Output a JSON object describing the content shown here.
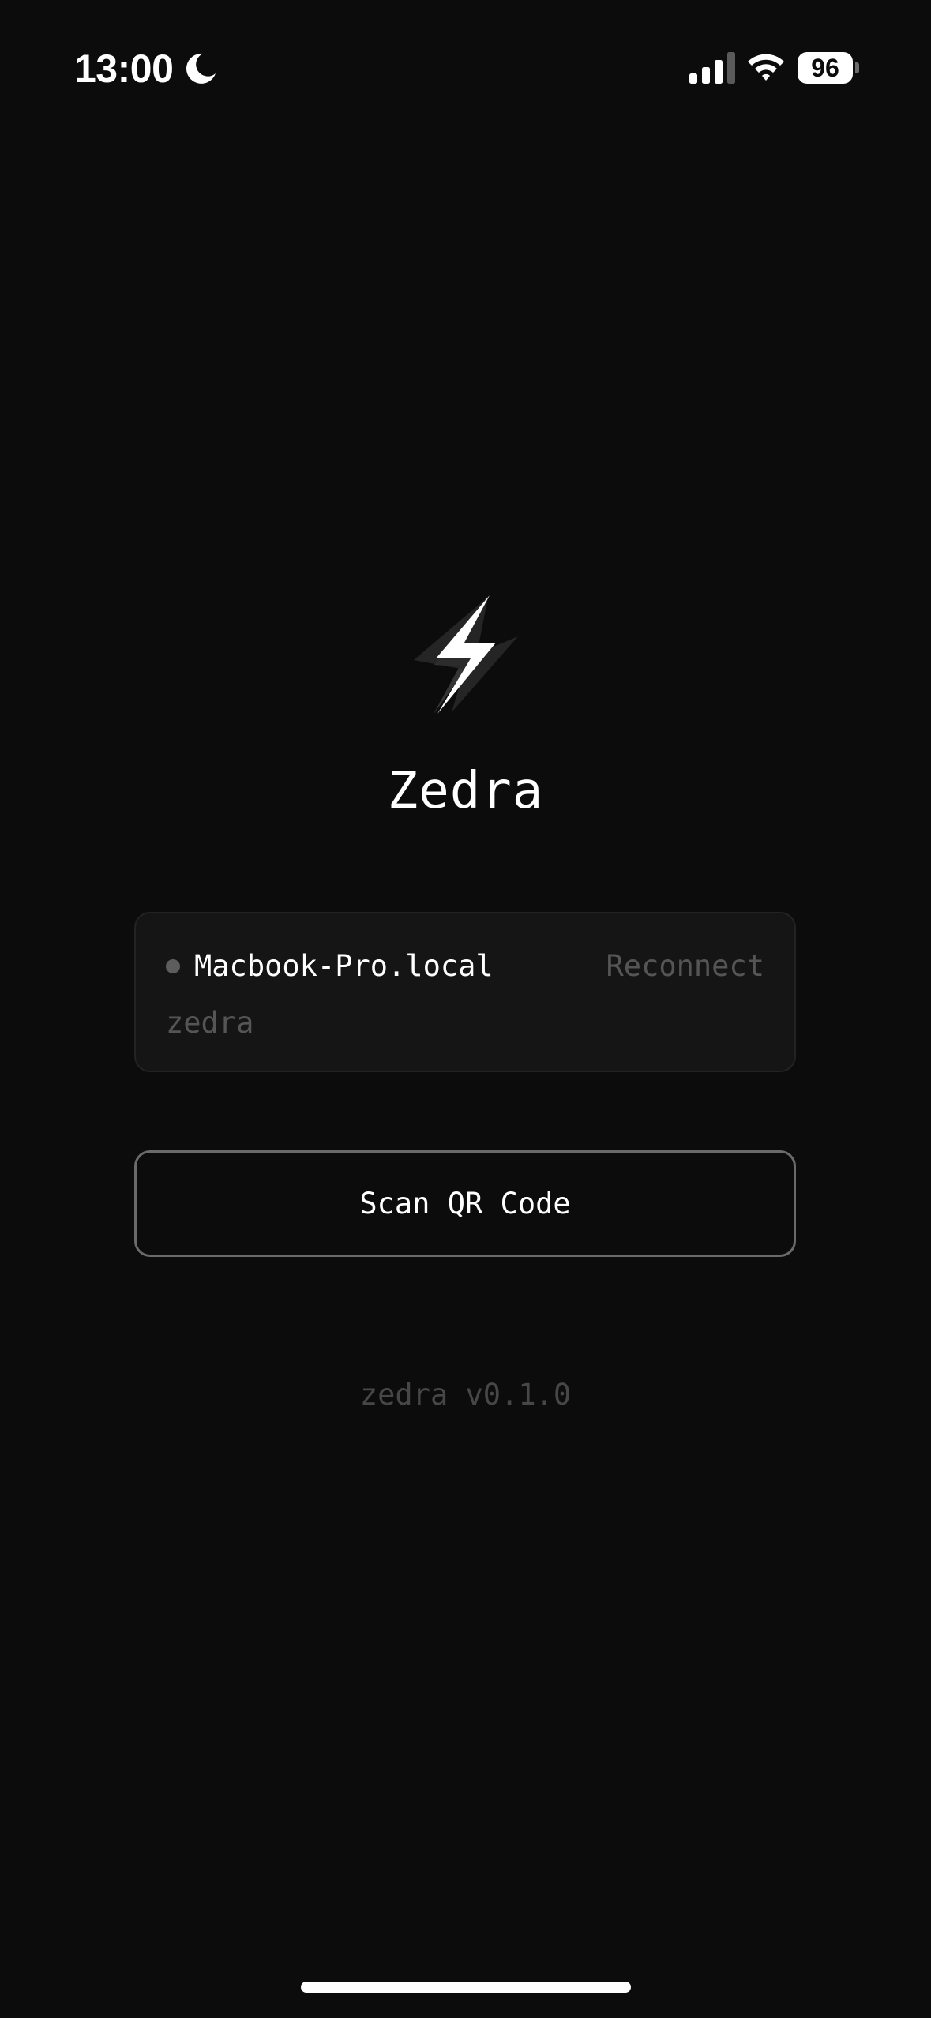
{
  "status_bar": {
    "time": "13:00",
    "battery_level": "96",
    "icons": [
      "moon-icon",
      "signal-icon",
      "wifi-icon",
      "battery-icon"
    ]
  },
  "app": {
    "logo_icon": "lightning-bolt-icon",
    "title": "Zedra",
    "version": "zedra v0.1.0"
  },
  "device_card": {
    "host": "Macbook-Pro.local",
    "user": "zedra",
    "action_label": "Reconnect",
    "status": "disconnected",
    "status_color": "#5d5d5d"
  },
  "scan_button": {
    "label": "Scan QR Code"
  },
  "colors": {
    "background": "#0d0c0d",
    "card_background": "#151515",
    "muted_text": "#555555",
    "button_border": "#6a6a6a"
  }
}
